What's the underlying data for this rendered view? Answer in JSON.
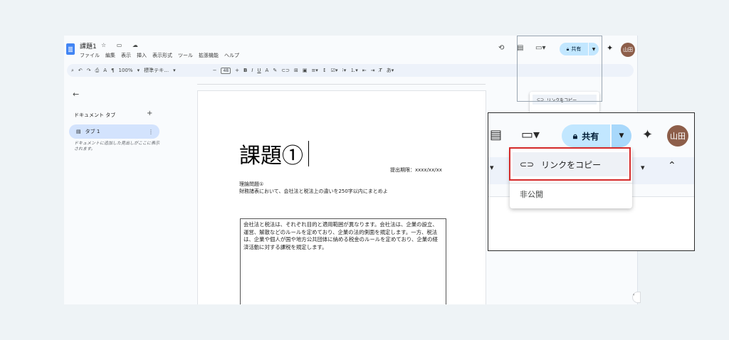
{
  "doc": {
    "title": "課題1",
    "title_icons": "☆ ▭ ☁",
    "menu": [
      "ファイル",
      "編集",
      "表示",
      "挿入",
      "表示形式",
      "ツール",
      "拡張機能",
      "ヘルプ"
    ]
  },
  "header": {
    "history_icon": "history-icon",
    "comment_icon": "comment-icon",
    "meet_icon": "video-icon",
    "share_label": "共有",
    "avatar_text": "山田"
  },
  "toolbar": {
    "zoom": "100%",
    "style": "標準テキ…",
    "font_size": "48",
    "items": [
      "B",
      "I",
      "U",
      "A"
    ]
  },
  "sidebar": {
    "heading": "ドキュメント タブ",
    "tab_label": "タブ 1",
    "hint": "ドキュメントに追加した見出しがここに表示されます。"
  },
  "page": {
    "big_title": "課題①",
    "deadline": "提出期限：xxxx/xx/xx",
    "question_title": "理論問題①",
    "question_body": "財務諸表において、会社法と税法上の違いを250字以内にまとめよ",
    "answer": "会社法と税法は、それぞれ目的と適用範囲が異なります。会社法は、企業の設立、運営、解散などのルールを定めており、企業の法的側面を規定します。一方、税法は、企業や個人が国や地方公共団体に納める税金のルールを定めており、企業の経済活動に対する課税を規定します。"
  },
  "share_menu": {
    "copy_link": "リンクをコピー",
    "visibility": "非公開"
  },
  "colors": {
    "share_bg": "#c2e7ff",
    "highlight_border": "#d52a2a",
    "avatar": "#8d5e4a"
  }
}
